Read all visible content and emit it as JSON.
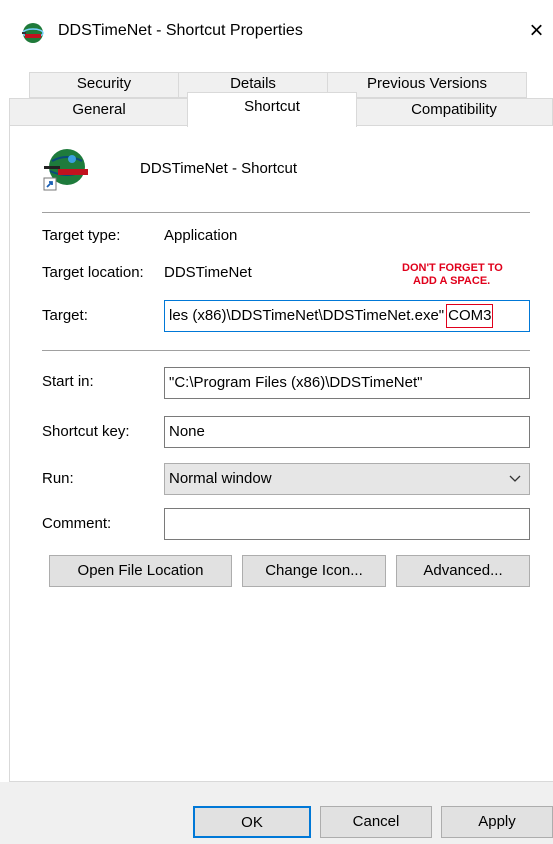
{
  "window": {
    "title": "DDSTimeNet - Shortcut Properties",
    "close_glyph": "×"
  },
  "tabs": {
    "row1": [
      "Security",
      "Details",
      "Previous Versions"
    ],
    "row2": [
      "General",
      "Shortcut",
      "Compatibility"
    ],
    "active": "Shortcut"
  },
  "shortcut": {
    "name": "DDSTimeNet - Shortcut",
    "target_type_label": "Target type:",
    "target_type_value": "Application",
    "target_location_label": "Target location:",
    "target_location_value": "DDSTimeNet",
    "target_label": "Target:",
    "target_value_main": "les (x86)\\DDSTimeNet\\DDSTimeNet.exe\"",
    "target_value_arg": "COM3",
    "start_in_label": "Start in:",
    "start_in_value": "\"C:\\Program Files (x86)\\DDSTimeNet\"",
    "shortcut_key_label": "Shortcut key:",
    "shortcut_key_value": "None",
    "run_label": "Run:",
    "run_value": "Normal window",
    "comment_label": "Comment:",
    "comment_value": ""
  },
  "annotation": {
    "line1": "DON'T FORGET TO",
    "line2": "ADD A SPACE.",
    "color": "#e0001b"
  },
  "buttons": {
    "open_file_location": "Open File Location",
    "change_icon": "Change Icon...",
    "advanced": "Advanced...",
    "ok": "OK",
    "cancel": "Cancel",
    "apply": "Apply"
  },
  "icons": {
    "app": "globe-clock-icon",
    "shortcut_overlay": "shortcut-arrow-icon",
    "dropdown": "chevron-down-icon"
  }
}
